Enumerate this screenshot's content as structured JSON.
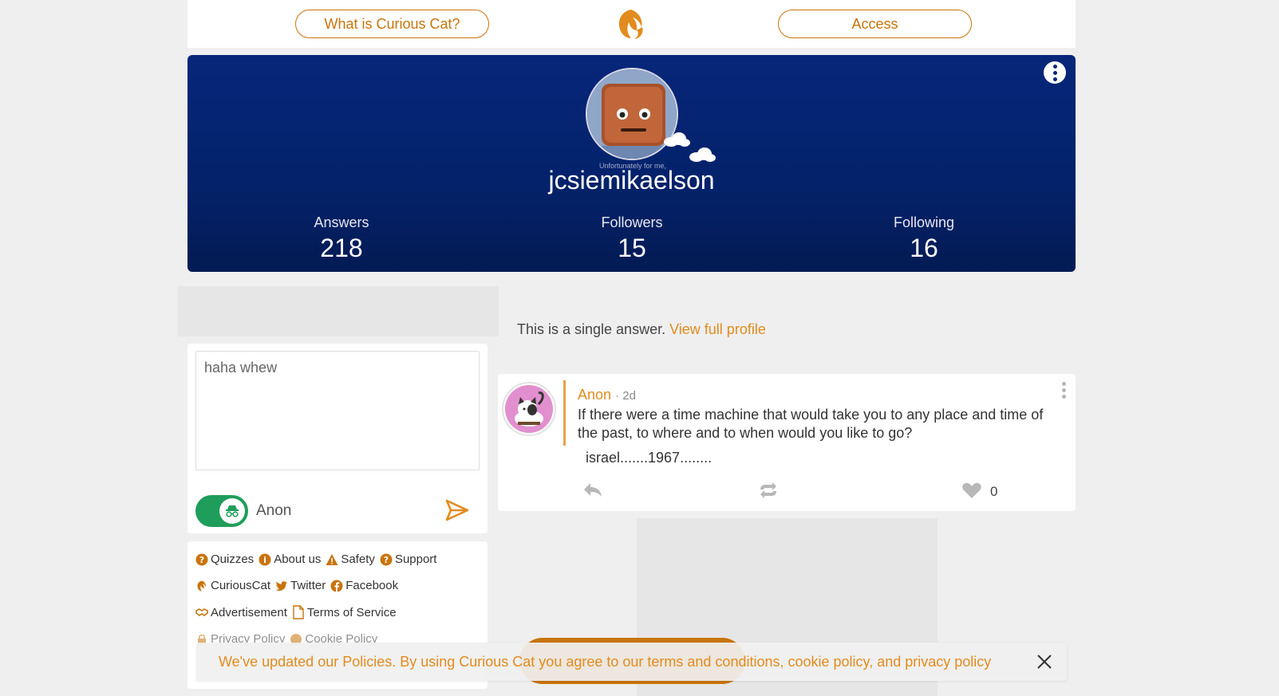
{
  "header": {
    "what_is_label": "What is Curious Cat?",
    "access_label": "Access",
    "logo_icon": "curiouscat-logo-icon",
    "accent_color": "#c8740b"
  },
  "profile": {
    "username": "jcsiemikaelson",
    "avatar_caption": "Unfortunately for me,",
    "stats": [
      {
        "label": "Answers",
        "value": "218"
      },
      {
        "label": "Followers",
        "value": "15"
      },
      {
        "label": "Following",
        "value": "16"
      }
    ],
    "background_color": "#06267a"
  },
  "single_answer": {
    "text": "This is a single answer.",
    "link": "View full profile"
  },
  "ask": {
    "text_value": "haha whew",
    "anon_label": "Anon",
    "anon_enabled": true
  },
  "footer_links": {
    "row1": [
      "Quizzes",
      "About us",
      "Safety",
      "Support"
    ],
    "row2": [
      "CuriousCat",
      "Twitter",
      "Facebook"
    ],
    "row3": [
      "Advertisement",
      "Terms of Service"
    ],
    "row4": [
      "Privacy Policy",
      "Cookie Policy"
    ]
  },
  "post": {
    "asker": "Anon",
    "time": "2d",
    "question": "If there were a time machine that would take you to any place and time of the past, to where and to when would you like to go?",
    "answer": "israel.......1967........",
    "likes": "0"
  },
  "policy_banner": {
    "text": "We've updated our Policies. By using Curious Cat you agree to our terms and conditions, cookie policy, and privacy policy"
  }
}
